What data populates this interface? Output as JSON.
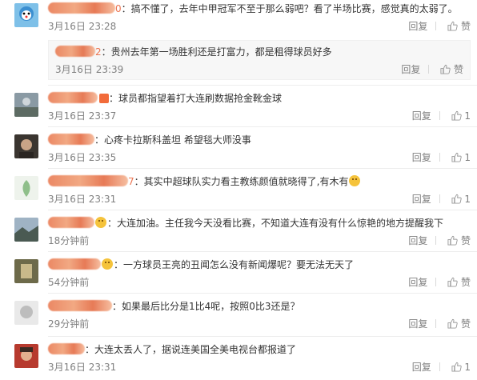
{
  "comments": [
    {
      "name_tail": "0",
      "text": "搞不懂了，去年中甲冠军不至于那么弱吧？看了半场比赛，感觉真的太弱了。",
      "time": "3月16日 23:28",
      "reply_label": "回复",
      "like_label": "赞",
      "like_count": ""
    },
    {
      "name_tail": "2",
      "text": "贵州去年第一场胜利还是打富力，都是租得球员好多",
      "time": "3月16日 23:39",
      "reply_label": "回复",
      "like_label": "赞",
      "like_count": ""
    },
    {
      "name_tail": "",
      "text": "球员都指望着打大连刷数据抢金靴金球",
      "time": "3月16日 23:37",
      "reply_label": "回复",
      "like_label": "",
      "like_count": "1"
    },
    {
      "name_tail": "",
      "text": "心疼卡拉斯科盖坦   希望毯大师没事",
      "time": "3月16日 23:35",
      "reply_label": "回复",
      "like_label": "",
      "like_count": "1"
    },
    {
      "name_tail": "7",
      "text": "其实中超球队实力看主教练颜值就晓得了,有木有",
      "time": "3月16日 23:31",
      "reply_label": "回复",
      "like_label": "",
      "like_count": "1"
    },
    {
      "name_tail": "",
      "text": "大连加油。主任我今天没看比赛，不知道大连有没有什么惊艳的地方提醒我下",
      "time": "18分钟前",
      "reply_label": "回复",
      "like_label": "赞",
      "like_count": ""
    },
    {
      "name_tail": "",
      "text": "一方球员王亮的丑闻怎么没有新闻爆呢？要无法无天了",
      "time": "54分钟前",
      "reply_label": "回复",
      "like_label": "赞",
      "like_count": ""
    },
    {
      "name_tail": "",
      "text": "如果最后比分是1比4呢，按照0比3还是？",
      "time": "29分钟前",
      "reply_label": "回复",
      "like_label": "赞",
      "like_count": ""
    },
    {
      "name_tail": "",
      "text": "大连太丢人了，据说连美国全美电视台都报道了",
      "time": "3月16日 23:31",
      "reply_label": "回复",
      "like_label": "",
      "like_count": "1"
    }
  ],
  "colors": {
    "name": "#eb7350",
    "meta": "#808080",
    "text": "#333333"
  },
  "icons": {
    "like": "thumbs-up-icon"
  }
}
